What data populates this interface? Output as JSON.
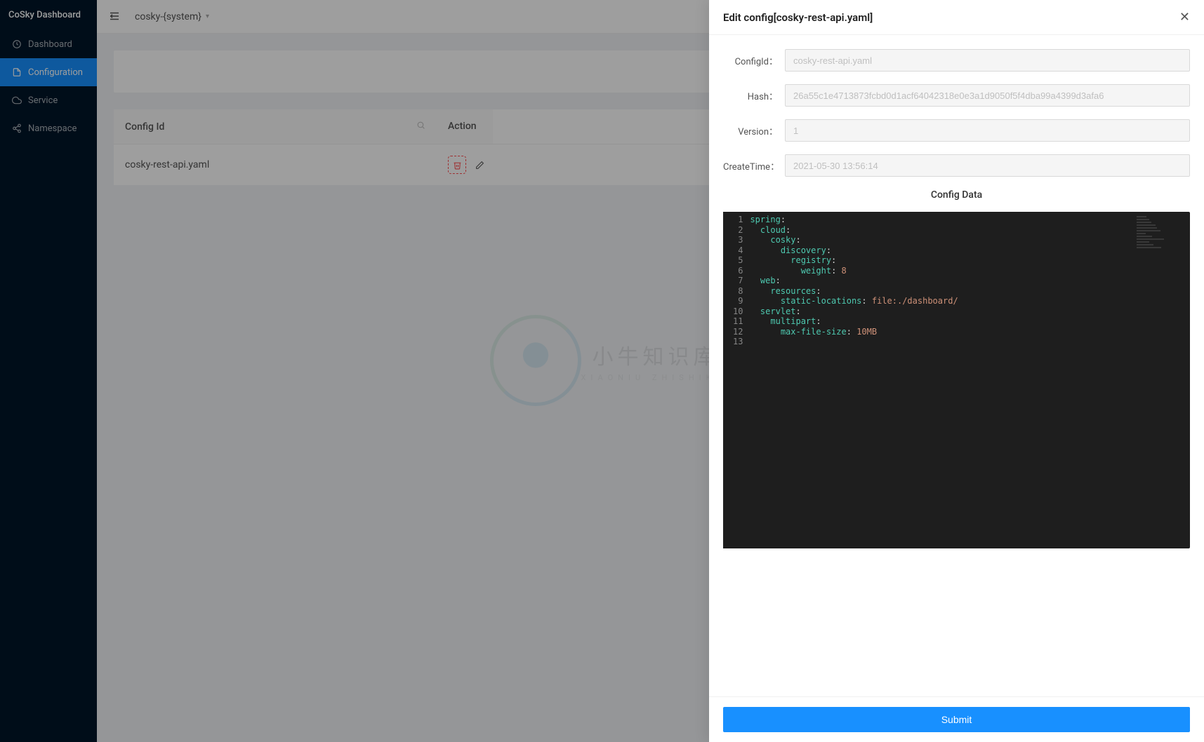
{
  "app_title": "CoSky Dashboard",
  "sidebar": {
    "items": [
      {
        "label": "Dashboard"
      },
      {
        "label": "Configuration"
      },
      {
        "label": "Service"
      },
      {
        "label": "Namespace"
      }
    ]
  },
  "header": {
    "namespace": "cosky-{system}"
  },
  "table": {
    "col_config_id": "Config Id",
    "col_action": "Action",
    "rows": [
      {
        "config_id": "cosky-rest-api.yaml"
      }
    ]
  },
  "drawer": {
    "title": "Edit config[cosky-rest-api.yaml]",
    "labels": {
      "config_id": "ConfigId：",
      "hash": "Hash：",
      "version": "Version：",
      "create_time": "CreateTime："
    },
    "values": {
      "config_id": "cosky-rest-api.yaml",
      "hash": "26a55c1e4713873fcbd0d1acf64042318e0e3a1d9050f5f4dba99a4399d3afa6",
      "version": "1",
      "create_time": "2021-05-30 13:56:14"
    },
    "config_data_label": "Config Data",
    "code": [
      [
        [
          "spring",
          "key"
        ],
        [
          ":",
          "punct"
        ]
      ],
      [
        [
          "  ",
          ""
        ],
        [
          "cloud",
          "key"
        ],
        [
          ":",
          "punct"
        ]
      ],
      [
        [
          "    ",
          ""
        ],
        [
          "cosky",
          "key"
        ],
        [
          ":",
          "punct"
        ]
      ],
      [
        [
          "      ",
          ""
        ],
        [
          "discovery",
          "key"
        ],
        [
          ":",
          "punct"
        ]
      ],
      [
        [
          "        ",
          ""
        ],
        [
          "registry",
          "key"
        ],
        [
          ":",
          "punct"
        ]
      ],
      [
        [
          "          ",
          ""
        ],
        [
          "weight",
          "key"
        ],
        [
          ": ",
          "punct"
        ],
        [
          "8",
          "str"
        ]
      ],
      [
        [
          "  ",
          ""
        ],
        [
          "web",
          "key"
        ],
        [
          ":",
          "punct"
        ]
      ],
      [
        [
          "    ",
          ""
        ],
        [
          "resources",
          "key"
        ],
        [
          ":",
          "punct"
        ]
      ],
      [
        [
          "      ",
          ""
        ],
        [
          "static-locations",
          "key"
        ],
        [
          ": ",
          "punct"
        ],
        [
          "file:./dashboard/",
          "str"
        ]
      ],
      [
        [
          "  ",
          ""
        ],
        [
          "servlet",
          "key"
        ],
        [
          ":",
          "punct"
        ]
      ],
      [
        [
          "    ",
          ""
        ],
        [
          "multipart",
          "key"
        ],
        [
          ":",
          "punct"
        ]
      ],
      [
        [
          "      ",
          ""
        ],
        [
          "max-file-size",
          "key"
        ],
        [
          ": ",
          "punct"
        ],
        [
          "10MB",
          "str"
        ]
      ],
      [
        [
          "",
          ""
        ]
      ]
    ],
    "submit_label": "Submit"
  },
  "watermark": {
    "main": "小牛知识库",
    "sub": "XIAONIU ZHISHIKU"
  }
}
